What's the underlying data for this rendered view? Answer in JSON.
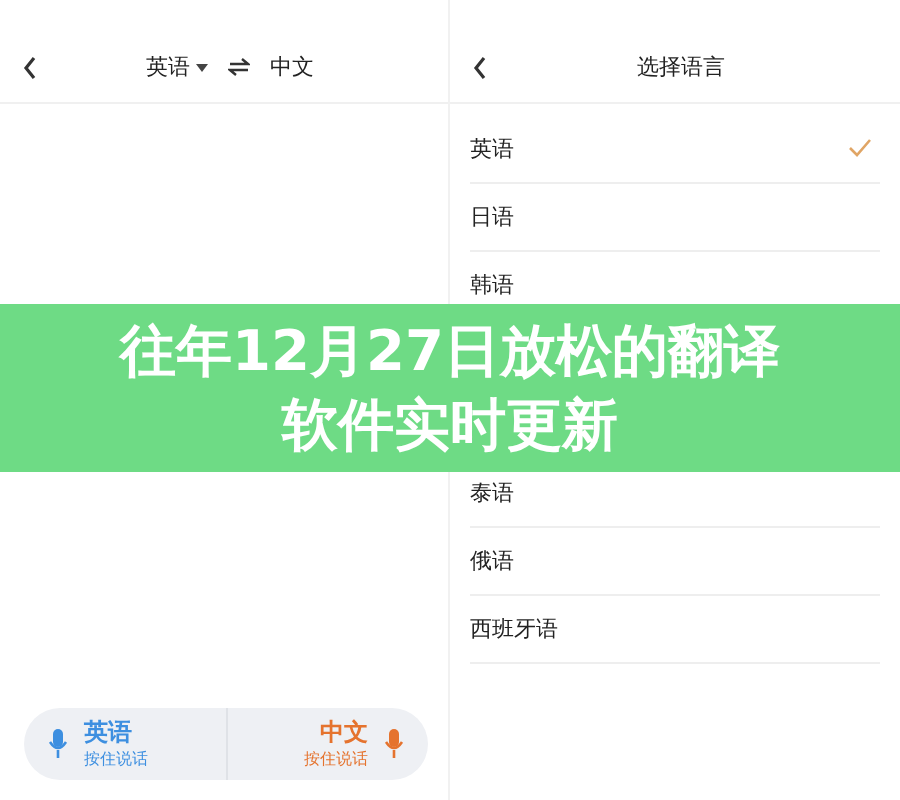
{
  "translator": {
    "source_language": "英语",
    "target_language": "中文",
    "voice_buttons": [
      {
        "kind": "left",
        "language": "英语",
        "hint": "按住说话",
        "color": "#3d8fe0"
      },
      {
        "kind": "right",
        "language": "中文",
        "hint": "按住说话",
        "color": "#e5732e"
      }
    ]
  },
  "language_picker": {
    "title": "选择语言",
    "languages": [
      {
        "label": "英语",
        "selected": true
      },
      {
        "label": "日语",
        "selected": false
      },
      {
        "label": "韩语",
        "selected": false
      },
      {
        "label": "泰语",
        "selected": false
      },
      {
        "label": "俄语",
        "selected": false
      },
      {
        "label": "西班牙语",
        "selected": false
      }
    ]
  },
  "banner": {
    "title_lines": [
      "往年12月27日放松的翻译",
      "软件实时更新"
    ]
  }
}
